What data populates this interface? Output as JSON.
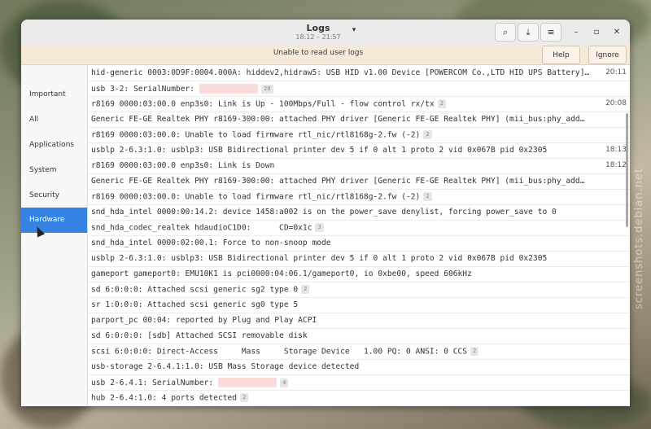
{
  "window": {
    "title": "Logs",
    "subtitle": "18:12 – 21:57"
  },
  "headerbar": {
    "icons": [
      "search-icon",
      "download-icon",
      "menu-icon",
      "minimize-icon",
      "maximize-icon",
      "close-icon"
    ],
    "glyphs": {
      "search": "⌕",
      "download": "⤓",
      "menu": "≡",
      "minimize": "–",
      "maximize": "▫",
      "close": "✕",
      "dropdown": "▾"
    }
  },
  "infobar": {
    "message": "Unable to read user logs",
    "help_label": "Help",
    "ignore_label": "Ignore"
  },
  "sidebar": {
    "items": [
      {
        "label": "Important"
      },
      {
        "label": "All"
      },
      {
        "label": "Applications"
      },
      {
        "label": "System"
      },
      {
        "label": "Security"
      },
      {
        "label": "Hardware"
      }
    ],
    "active": "Hardware"
  },
  "logs": [
    {
      "msg": "hid-generic 0003:0D9F:0004.000A: hiddev2,hidraw5: USB HID v1.00 Device [POWERCOM Co.,LTD HID UPS Battery]…",
      "time": "20:11"
    },
    {
      "msg": "usb 3-2: SerialNumber:",
      "badge": "20",
      "redacted": true
    },
    {
      "msg": "r8169 0000:03:00.0 enp3s0: Link is Up - 100Mbps/Full - flow control rx/tx",
      "badge": "2",
      "time": "20:08"
    },
    {
      "msg": "Generic FE-GE Realtek PHY r8169-300:00: attached PHY driver [Generic FE-GE Realtek PHY] (mii_bus:phy_add…"
    },
    {
      "msg": "r8169 0000:03:00.0: Unable to load firmware rtl_nic/rtl8168g-2.fw (-2)",
      "badge": "2"
    },
    {
      "msg": "usblp 2-6.3:1.0: usblp3: USB Bidirectional printer dev 5 if 0 alt 1 proto 2 vid 0x067B pid 0x2305",
      "time": "18:13"
    },
    {
      "msg": "r8169 0000:03:00.0 enp3s0: Link is Down",
      "time": "18:12"
    },
    {
      "msg": "Generic FE-GE Realtek PHY r8169-300:00: attached PHY driver [Generic FE-GE Realtek PHY] (mii_bus:phy_add…"
    },
    {
      "msg": "r8169 0000:03:00.0: Unable to load firmware rtl_nic/rtl8168g-2.fw (-2)",
      "badge": "2"
    },
    {
      "msg": "snd_hda_intel 0000:00:14.2: device 1458:a002 is on the power_save denylist, forcing power_save to 0"
    },
    {
      "msg": "snd_hda_codec_realtek hdaudioC1D0:      CD=0x1c",
      "badge": "3"
    },
    {
      "msg": "snd_hda_intel 0000:02:00.1: Force to non-snoop mode"
    },
    {
      "msg": "usblp 2-6.3:1.0: usblp3: USB Bidirectional printer dev 5 if 0 alt 1 proto 2 vid 0x067B pid 0x2305"
    },
    {
      "msg": "gameport gameport0: EMU10K1 is pci0000:04:06.1/gameport0, io 0xbe00, speed 606kHz"
    },
    {
      "msg": "sd 6:0:0:0: Attached scsi generic sg2 type 0",
      "badge": "2"
    },
    {
      "msg": "sr 1:0:0:0: Attached scsi generic sg0 type 5"
    },
    {
      "msg": "parport_pc 00:04: reported by Plug and Play ACPI"
    },
    {
      "msg": "sd 6:0:0:0: [sdb] Attached SCSI removable disk"
    },
    {
      "msg": "scsi 6:0:0:0: Direct-Access     Mass     Storage Device   1.00 PQ: 0 ANSI: 0 CCS",
      "badge": "2"
    },
    {
      "msg": "usb-storage 2-6.4.1:1.0: USB Mass Storage device detected"
    },
    {
      "msg": "usb 2-6.4.1: SerialNumber:",
      "badge": "4",
      "redacted": true
    },
    {
      "msg": "hub 2-6.4:1.0: 4 ports detected",
      "badge": "2"
    }
  ],
  "watermark": "screenshots.debian.net",
  "colors": {
    "accent": "#3584e4",
    "infobar": "#f7e9d8",
    "redacted": "#fbdcdc"
  }
}
